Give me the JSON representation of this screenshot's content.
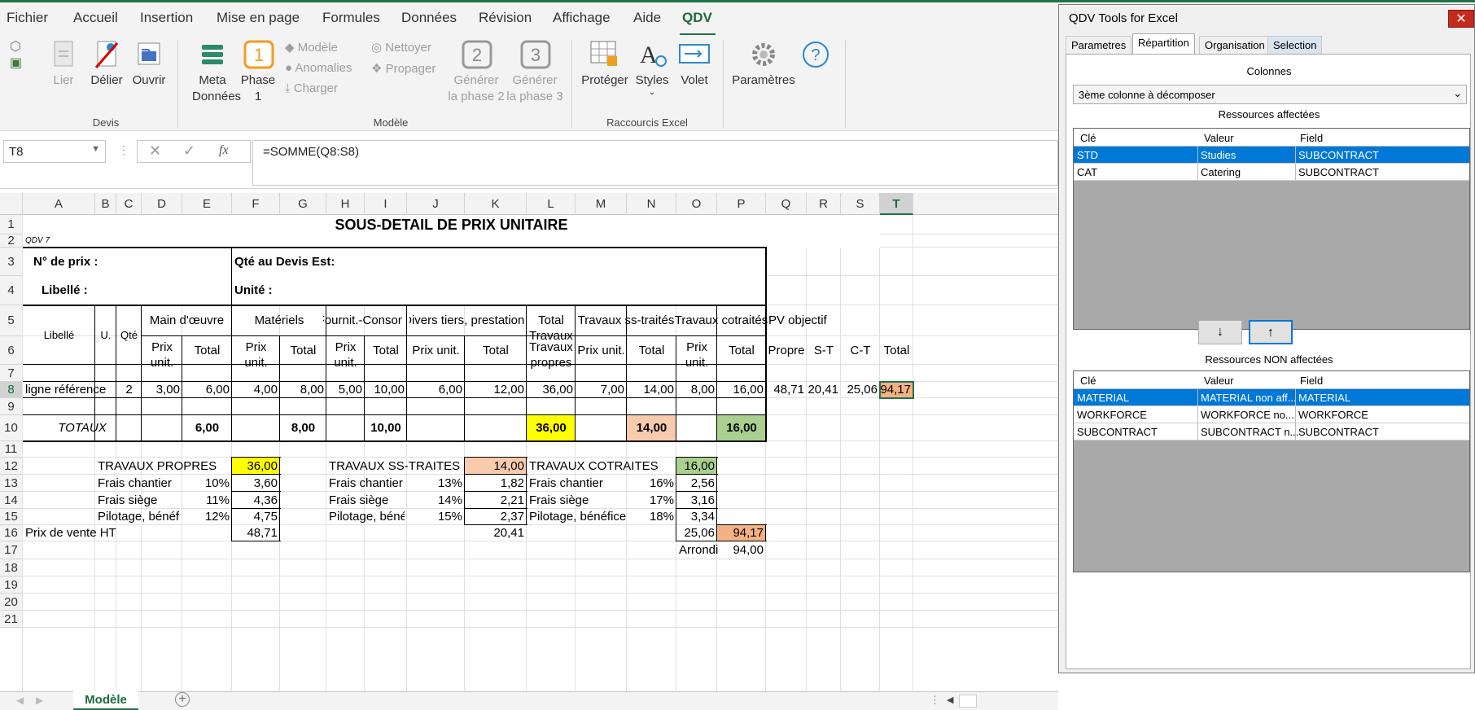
{
  "ribbon": {
    "tabs": [
      "Fichier",
      "Accueil",
      "Insertion",
      "Mise en page",
      "Formules",
      "Données",
      "Révision",
      "Affichage",
      "Aide",
      "QDV"
    ],
    "active_tab": "QDV",
    "devis": {
      "lier": "Lier",
      "delier": "Délier",
      "ouvrir": "Ouvrir",
      "group": "Devis"
    },
    "modele": {
      "meta1": "Meta",
      "meta2": "Données",
      "phase": "Phase",
      "phase_num": "1",
      "phase1_icon_num": "1",
      "modele": "Modèle",
      "anomalies": "Anomalies",
      "charger": "Charger",
      "nettoyer": "Nettoyer",
      "propager": "Propager",
      "gen2a": "Générer",
      "gen2b": "la phase 2",
      "gen3a": "Générer",
      "gen3b": "la phase 3",
      "num2": "2",
      "num3": "3",
      "group": "Modèle"
    },
    "raccourcis": {
      "proteger": "Protéger",
      "styles": "Styles",
      "volet": "Volet",
      "group": "Raccourcis Excel"
    },
    "parametres": "Paramètres"
  },
  "formula_bar": {
    "name_box": "T8",
    "formula": "=SOMME(Q8:S8)",
    "fx": "fx"
  },
  "columns": [
    "A",
    "B",
    "C",
    "D",
    "E",
    "F",
    "G",
    "H",
    "I",
    "J",
    "K",
    "L",
    "M",
    "N",
    "O",
    "P",
    "Q",
    "R",
    "S",
    "T"
  ],
  "rows": [
    "1",
    "2",
    "3",
    "4",
    "5",
    "6",
    "7",
    "8",
    "9",
    "10",
    "11",
    "12",
    "13",
    "14",
    "15",
    "16",
    "17",
    "18",
    "19",
    "20",
    "21"
  ],
  "sheet": {
    "title": "SOUS-DETAIL DE PRIX UNITAIRE",
    "qdv": "QDV 7",
    "no_prix": "N° de prix :",
    "qte_devis": "Qté au Devis Est:",
    "libelle_lbl": "Libellé :",
    "unite": "Unité :",
    "h_libelle": "Libellé",
    "h_u": "U.",
    "h_qte": "Qté",
    "h_main": "Main d'œuvre",
    "h_mat": "Matériels",
    "h_fourn": "Fournit.-Consom",
    "h_divers": "Divers tiers, prestations",
    "h_total": "Total",
    "h_travaux": "Travaux",
    "h_propres": "propres",
    "h_ss": "Travaux ss-traités",
    "h_cot": "Travaux cotraités",
    "h_pv": "PV objectif",
    "prix": "Prix",
    "unit": "unit.",
    "total": "Total",
    "prix_unit": "Prix unit.",
    "propre": "Propre",
    "st": "S-T",
    "ct": "C-T",
    "row8": {
      "lib": "ligne référence",
      "qte": "2",
      "d": "3,00",
      "e": "6,00",
      "f": "4,00",
      "g": "8,00",
      "h": "5,00",
      "i": "10,00",
      "j": "6,00",
      "k": "12,00",
      "l": "36,00",
      "m": "7,00",
      "n": "14,00",
      "o": "8,00",
      "p": "16,00",
      "q": "48,71",
      "r": "20,41",
      "s": "25,06",
      "t": "94,17"
    },
    "totaux": {
      "label": "TOTAUX",
      "e": "6,00",
      "g": "8,00",
      "i": "10,00",
      "l": "36,00",
      "n": "14,00",
      "p": "16,00"
    },
    "recap": {
      "tp": "TRAVAUX PROPRES",
      "tp_v": "36,00",
      "fc": "Frais chantier",
      "fc1": "10%",
      "fc1v": "3,60",
      "fs": "Frais siège",
      "fs1": "11%",
      "fs1v": "4,36",
      "pb": "Pilotage, bénéfi",
      "pb1": "12%",
      "pb1v": "4,75",
      "pv": "Prix de vente HT",
      "pv1": "48,71",
      "ts": "TRAVAUX SS-TRAITES",
      "ts_v": "14,00",
      "fc2": "13%",
      "fc2v": "1,82",
      "fs2": "14%",
      "fs2v": "2,21",
      "pb2": "15%",
      "pb2v": "2,37",
      "pv2": "20,41",
      "tc": "TRAVAUX COTRAITES",
      "tc_v": "16,00",
      "pb_full": "Pilotage, bénéfice",
      "fc3": "16%",
      "fc3v": "2,56",
      "fs3": "17%",
      "fs3v": "3,16",
      "pb3": "18%",
      "pb3v": "3,34",
      "pv3": "25,06",
      "pv_total": "94,17",
      "arrondi": "Arrondi",
      "arrondi_v": "94,00"
    }
  },
  "sheet_tab": "Modèle",
  "dialog": {
    "title": "QDV Tools for Excel",
    "close": "✕",
    "tabs": [
      "Parametres",
      "Répartition",
      "Organisation",
      "Selection"
    ],
    "colonnes": "Colonnes",
    "combo": "3ème colonne à décomposer",
    "affectees": "Ressources affectées",
    "non_affectees": "Ressources NON affectées",
    "headers": [
      "Clé",
      "Valeur",
      "Field"
    ],
    "affected_rows": [
      [
        "STD",
        "Studies",
        "SUBCONTRACT"
      ],
      [
        "CAT",
        "Catering",
        "SUBCONTRACT"
      ]
    ],
    "unaffected_rows": [
      [
        "MATERIAL",
        "MATERIAL non aff...",
        "MATERIAL"
      ],
      [
        "WORKFORCE",
        "WORKFORCE no...",
        "WORKFORCE"
      ],
      [
        "SUBCONTRACT",
        "SUBCONTRACT n...",
        "SUBCONTRACT"
      ]
    ],
    "down": "↓",
    "up": "↑"
  },
  "colors": {
    "yellow": "#ffff00",
    "salmon": "#f8cbad",
    "green": "#a9d08e",
    "orange": "#f4b183",
    "accent": "#217346",
    "selection": "#0078d7"
  }
}
